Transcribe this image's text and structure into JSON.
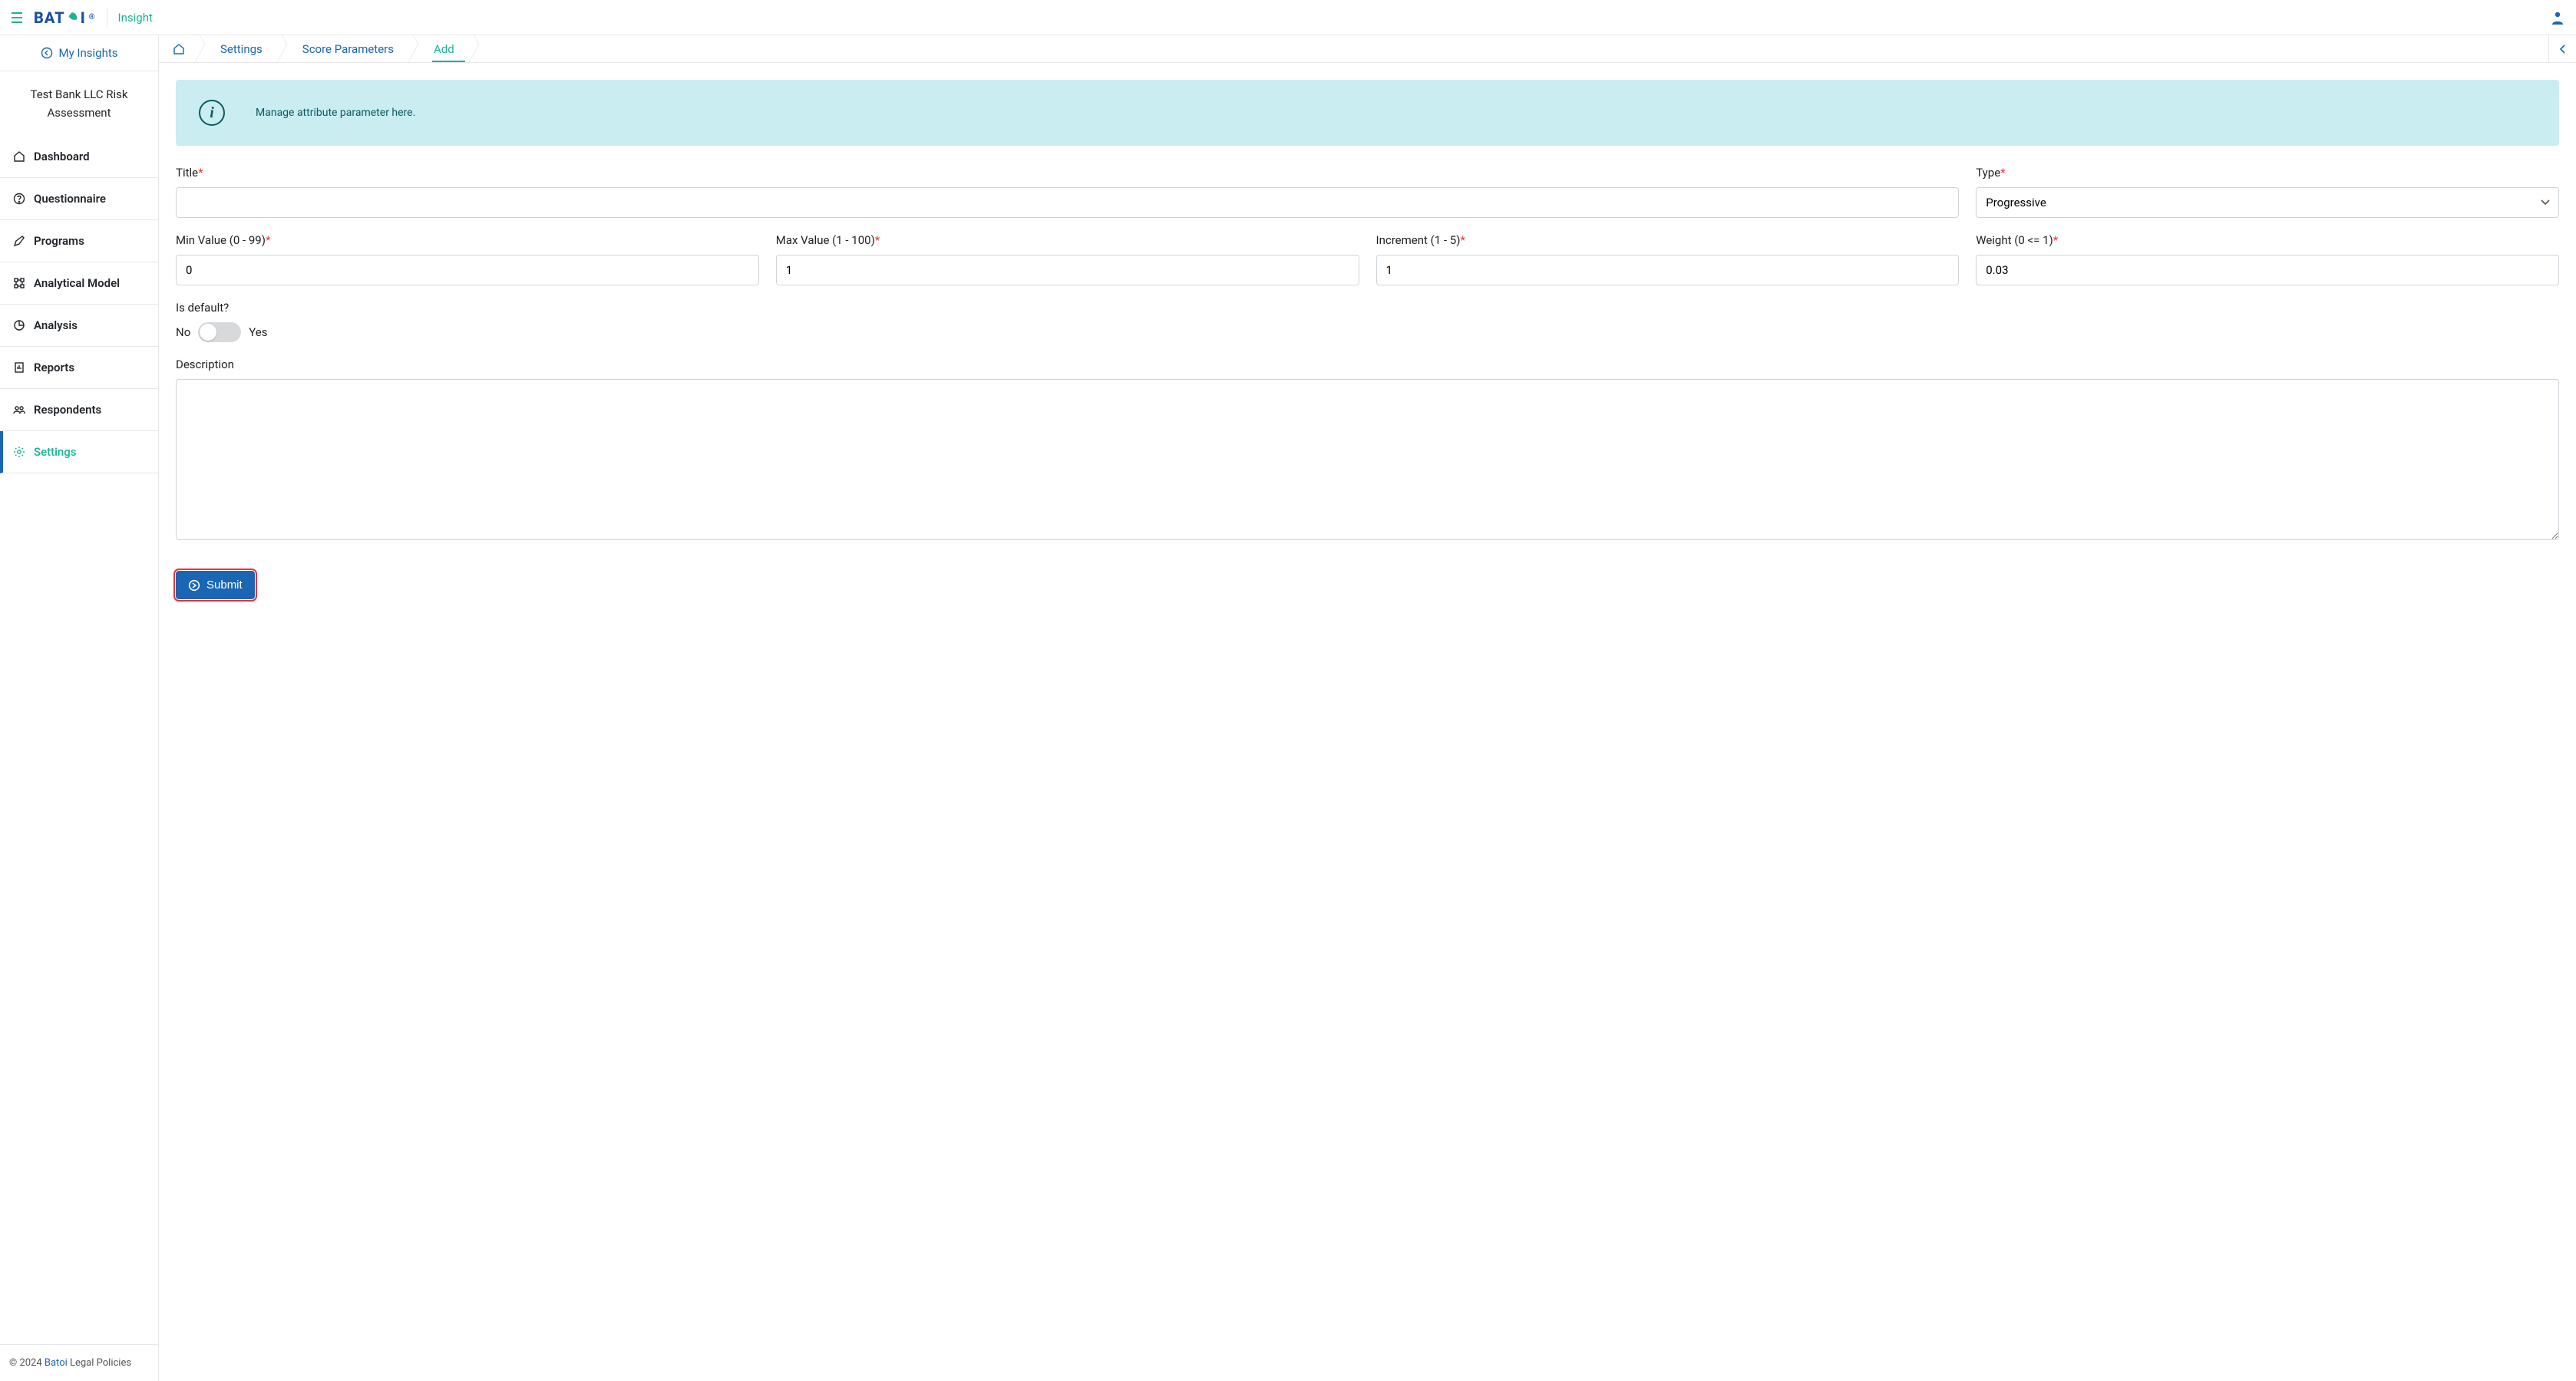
{
  "header": {
    "logo_text_1": "BAT",
    "logo_text_2": "I",
    "logo_reg": "®",
    "product": "Insight"
  },
  "sidebar": {
    "my_insights": "My Insights",
    "project_title": "Test Bank LLC Risk Assessment",
    "nav": [
      {
        "label": "Dashboard"
      },
      {
        "label": "Questionnaire"
      },
      {
        "label": "Programs"
      },
      {
        "label": "Analytical Model"
      },
      {
        "label": "Analysis"
      },
      {
        "label": "Reports"
      },
      {
        "label": "Respondents"
      },
      {
        "label": "Settings"
      }
    ],
    "footer": {
      "copyright": "© 2024 ",
      "brand": "Batoi",
      "policies": " Legal Policies"
    }
  },
  "breadcrumbs": {
    "items": [
      {
        "label": "Settings"
      },
      {
        "label": "Score Parameters"
      },
      {
        "label": "Add"
      }
    ]
  },
  "info": {
    "text": "Manage attribute parameter here."
  },
  "form": {
    "title": {
      "label": "Title",
      "value": ""
    },
    "type": {
      "label": "Type",
      "value": "Progressive"
    },
    "min": {
      "label": "Min Value (0 - 99)",
      "value": "0"
    },
    "max": {
      "label": "Max Value (1 - 100)",
      "value": "1"
    },
    "increment": {
      "label": "Increment (1 - 5)",
      "value": "1"
    },
    "weight": {
      "label": "Weight (0 <= 1)",
      "value": "0.03"
    },
    "is_default": {
      "label": "Is default?",
      "no": "No",
      "yes": "Yes"
    },
    "description": {
      "label": "Description",
      "value": ""
    },
    "submit": "Submit"
  }
}
